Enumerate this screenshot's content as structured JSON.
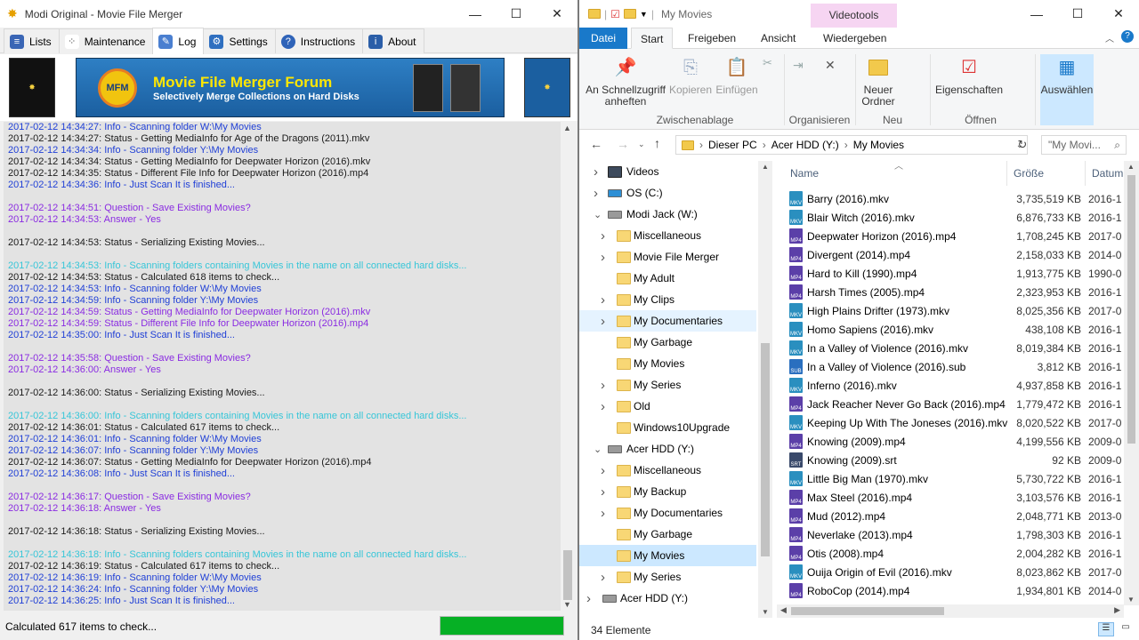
{
  "left_window": {
    "title": "Modi Original - Movie File Merger",
    "tabs": [
      {
        "label": "Lists",
        "icon": "lists-icon"
      },
      {
        "label": "Maintenance",
        "icon": "maintenance-icon"
      },
      {
        "label": "Log",
        "icon": "log-icon"
      },
      {
        "label": "Settings",
        "icon": "gear-icon"
      },
      {
        "label": "Instructions",
        "icon": "help-icon"
      },
      {
        "label": "About",
        "icon": "about-icon"
      }
    ],
    "active_tab": "Log",
    "banner": {
      "title": "Movie File Merger Forum",
      "subtitle": "Selectively Merge Collections on Hard Disks",
      "badge": "MFM"
    },
    "log_lines": [
      {
        "text": "2017-02-12 14:34:27: Info - Scanning folder W:\\My Movies",
        "type": "blue"
      },
      {
        "text": "2017-02-12 14:34:27: Status - Getting MediaInfo for Age of the Dragons (2011).mkv",
        "type": "black"
      },
      {
        "text": "2017-02-12 14:34:34: Info - Scanning folder Y:\\My Movies",
        "type": "blue"
      },
      {
        "text": "2017-02-12 14:34:34: Status - Getting MediaInfo for Deepwater Horizon (2016).mkv",
        "type": "black"
      },
      {
        "text": "2017-02-12 14:34:35: Status - Different File Info for Deepwater Horizon (2016).mp4",
        "type": "black"
      },
      {
        "text": "2017-02-12 14:34:36: Info - Just Scan It is finished...",
        "type": "blue"
      },
      {
        "text": "",
        "type": "black"
      },
      {
        "text": "2017-02-12 14:34:51: Question - Save Existing Movies?",
        "type": "purple"
      },
      {
        "text": "2017-02-12 14:34:53: Answer - Yes",
        "type": "purple"
      },
      {
        "text": "",
        "type": "black"
      },
      {
        "text": "2017-02-12 14:34:53: Status - Serializing Existing Movies...",
        "type": "black"
      },
      {
        "text": "",
        "type": "black"
      },
      {
        "text": "2017-02-12 14:34:53: Info - Scanning folders containing Movies in the name on all connected hard disks...",
        "type": "cyan"
      },
      {
        "text": "2017-02-12 14:34:53: Status - Calculated 618 items to check...",
        "type": "black"
      },
      {
        "text": "2017-02-12 14:34:53: Info - Scanning folder W:\\My Movies",
        "type": "blue"
      },
      {
        "text": "2017-02-12 14:34:59: Info - Scanning folder Y:\\My Movies",
        "type": "blue"
      },
      {
        "text": "2017-02-12 14:34:59: Status - Getting MediaInfo for Deepwater Horizon (2016).mkv",
        "type": "purple"
      },
      {
        "text": "2017-02-12 14:34:59: Status - Different File Info for Deepwater Horizon (2016).mp4",
        "type": "purple"
      },
      {
        "text": "2017-02-12 14:35:00: Info - Just Scan It is finished...",
        "type": "blue"
      },
      {
        "text": "",
        "type": "black"
      },
      {
        "text": "2017-02-12 14:35:58: Question - Save Existing Movies?",
        "type": "purple"
      },
      {
        "text": "2017-02-12 14:36:00: Answer - Yes",
        "type": "purple"
      },
      {
        "text": "",
        "type": "black"
      },
      {
        "text": "2017-02-12 14:36:00: Status - Serializing Existing Movies...",
        "type": "black"
      },
      {
        "text": "",
        "type": "black"
      },
      {
        "text": "2017-02-12 14:36:00: Info - Scanning folders containing Movies in the name on all connected hard disks...",
        "type": "cyan"
      },
      {
        "text": "2017-02-12 14:36:01: Status - Calculated 617 items to check...",
        "type": "black"
      },
      {
        "text": "2017-02-12 14:36:01: Info - Scanning folder W:\\My Movies",
        "type": "blue"
      },
      {
        "text": "2017-02-12 14:36:07: Info - Scanning folder Y:\\My Movies",
        "type": "blue"
      },
      {
        "text": "2017-02-12 14:36:07: Status - Getting MediaInfo for Deepwater Horizon (2016).mp4",
        "type": "black"
      },
      {
        "text": "2017-02-12 14:36:08: Info - Just Scan It is finished...",
        "type": "blue"
      },
      {
        "text": "",
        "type": "black"
      },
      {
        "text": "2017-02-12 14:36:17: Question - Save Existing Movies?",
        "type": "purple"
      },
      {
        "text": "2017-02-12 14:36:18: Answer - Yes",
        "type": "purple"
      },
      {
        "text": "",
        "type": "black"
      },
      {
        "text": "2017-02-12 14:36:18: Status - Serializing Existing Movies...",
        "type": "black"
      },
      {
        "text": "",
        "type": "black"
      },
      {
        "text": "2017-02-12 14:36:18: Info - Scanning folders containing Movies in the name on all connected hard disks...",
        "type": "cyan"
      },
      {
        "text": "2017-02-12 14:36:19: Status - Calculated 617 items to check...",
        "type": "black"
      },
      {
        "text": "2017-02-12 14:36:19: Info - Scanning folder W:\\My Movies",
        "type": "blue"
      },
      {
        "text": "2017-02-12 14:36:24: Info - Scanning folder Y:\\My Movies",
        "type": "blue"
      },
      {
        "text": "2017-02-12 14:36:25: Info - Just Scan It is finished...",
        "type": "blue"
      }
    ],
    "status_text": "Calculated 617 items to check...",
    "progress": 1.0,
    "colors": {
      "progress": "#06b025",
      "info": "#1f3fd6",
      "question": "#8a2be2",
      "scan": "#36c6d8"
    }
  },
  "right_window": {
    "title": "My Movies",
    "contextual_tab": "Videotools",
    "ribbon_tabs": [
      "Datei",
      "Start",
      "Freigeben",
      "Ansicht",
      "Wiedergeben"
    ],
    "active_ribbon_tab": "Start",
    "ribbon": {
      "pin": "An Schnellzugriff anheften",
      "copy": "Kopieren",
      "paste": "Einfügen",
      "group_clipboard": "Zwischenablage",
      "group_organize": "Organisieren",
      "new_folder": "Neuer Ordner",
      "group_new": "Neu",
      "properties": "Eigenschaften",
      "group_open": "Öffnen",
      "select": "Auswählen"
    },
    "address": {
      "breadcrumbs": [
        "Dieser PC",
        "Acer HDD (Y:)",
        "My Movies"
      ],
      "search_placeholder": "\"My Movi..."
    },
    "nav_tree": [
      {
        "label": "Videos",
        "level": 1,
        "kind": "videos",
        "chevron": "right"
      },
      {
        "label": "OS (C:)",
        "level": 1,
        "kind": "os-drive",
        "chevron": "right"
      },
      {
        "label": "Modi Jack (W:)",
        "level": 1,
        "kind": "drive",
        "chevron": "down"
      },
      {
        "label": "Miscellaneous",
        "level": 2,
        "kind": "folder",
        "chevron": "right"
      },
      {
        "label": "Movie File Merger",
        "level": 2,
        "kind": "folder",
        "chevron": "right"
      },
      {
        "label": "My Adult",
        "level": 2,
        "kind": "folder",
        "chevron": ""
      },
      {
        "label": "My Clips",
        "level": 2,
        "kind": "folder",
        "chevron": "right"
      },
      {
        "label": "My Documentaries",
        "level": 2,
        "kind": "folder",
        "chevron": "right",
        "state": "hover"
      },
      {
        "label": "My Garbage",
        "level": 2,
        "kind": "folder",
        "chevron": ""
      },
      {
        "label": "My Movies",
        "level": 2,
        "kind": "folder",
        "chevron": ""
      },
      {
        "label": "My Series",
        "level": 2,
        "kind": "folder",
        "chevron": "right"
      },
      {
        "label": "Old",
        "level": 2,
        "kind": "folder",
        "chevron": "right"
      },
      {
        "label": "Windows10Upgrade",
        "level": 2,
        "kind": "folder",
        "chevron": ""
      },
      {
        "label": "Acer HDD (Y:)",
        "level": 1,
        "kind": "drive",
        "chevron": "down"
      },
      {
        "label": "Miscellaneous",
        "level": 2,
        "kind": "folder",
        "chevron": "right"
      },
      {
        "label": "My Backup",
        "level": 2,
        "kind": "folder",
        "chevron": "right"
      },
      {
        "label": "My Documentaries",
        "level": 2,
        "kind": "folder",
        "chevron": "right"
      },
      {
        "label": "My Garbage",
        "level": 2,
        "kind": "folder",
        "chevron": ""
      },
      {
        "label": "My Movies",
        "level": 2,
        "kind": "folder",
        "chevron": "",
        "state": "selected"
      },
      {
        "label": "My Series",
        "level": 2,
        "kind": "folder",
        "chevron": "right"
      },
      {
        "label": "Acer HDD (Y:)",
        "level": 0,
        "kind": "drive",
        "chevron": "right"
      }
    ],
    "columns": {
      "name": "Name",
      "size": "Größe",
      "date": "Datum"
    },
    "files": [
      {
        "name": "Barry (2016).mkv",
        "size": "3,735,519 KB",
        "date": "2016-1",
        "ext": "MKV"
      },
      {
        "name": "Blair Witch (2016).mkv",
        "size": "6,876,733 KB",
        "date": "2016-1",
        "ext": "MKV"
      },
      {
        "name": "Deepwater Horizon (2016).mp4",
        "size": "1,708,245 KB",
        "date": "2017-0",
        "ext": "MP4"
      },
      {
        "name": "Divergent (2014).mp4",
        "size": "2,158,033 KB",
        "date": "2014-0",
        "ext": "MP4"
      },
      {
        "name": "Hard to Kill (1990).mp4",
        "size": "1,913,775 KB",
        "date": "1990-0",
        "ext": "MP4"
      },
      {
        "name": "Harsh Times (2005).mp4",
        "size": "2,323,953 KB",
        "date": "2016-1",
        "ext": "MP4"
      },
      {
        "name": "High Plains Drifter (1973).mkv",
        "size": "8,025,356 KB",
        "date": "2017-0",
        "ext": "MKV"
      },
      {
        "name": "Homo Sapiens (2016).mkv",
        "size": "438,108 KB",
        "date": "2016-1",
        "ext": "MKV"
      },
      {
        "name": "In a Valley of Violence (2016).mkv",
        "size": "8,019,384 KB",
        "date": "2016-1",
        "ext": "MKV"
      },
      {
        "name": "In a Valley of Violence (2016).sub",
        "size": "3,812 KB",
        "date": "2016-1",
        "ext": "SUB"
      },
      {
        "name": "Inferno (2016).mkv",
        "size": "4,937,858 KB",
        "date": "2016-1",
        "ext": "MKV"
      },
      {
        "name": "Jack Reacher Never Go Back (2016).mp4",
        "size": "1,779,472 KB",
        "date": "2016-1",
        "ext": "MP4"
      },
      {
        "name": "Keeping Up With The Joneses (2016).mkv",
        "size": "8,020,522 KB",
        "date": "2017-0",
        "ext": "MKV"
      },
      {
        "name": "Knowing (2009).mp4",
        "size": "4,199,556 KB",
        "date": "2009-0",
        "ext": "MP4"
      },
      {
        "name": "Knowing (2009).srt",
        "size": "92 KB",
        "date": "2009-0",
        "ext": "SRT"
      },
      {
        "name": "Little Big Man (1970).mkv",
        "size": "5,730,722 KB",
        "date": "2016-1",
        "ext": "MKV"
      },
      {
        "name": "Max Steel (2016).mp4",
        "size": "3,103,576 KB",
        "date": "2016-1",
        "ext": "MP4"
      },
      {
        "name": "Mud (2012).mp4",
        "size": "2,048,771 KB",
        "date": "2013-0",
        "ext": "MP4"
      },
      {
        "name": "Neverlake (2013).mp4",
        "size": "1,798,303 KB",
        "date": "2016-1",
        "ext": "MP4"
      },
      {
        "name": "Otis (2008).mp4",
        "size": "2,004,282 KB",
        "date": "2016-1",
        "ext": "MP4"
      },
      {
        "name": "Ouija Origin of Evil (2016).mkv",
        "size": "8,023,862 KB",
        "date": "2017-0",
        "ext": "MKV"
      },
      {
        "name": "RoboCop (2014).mp4",
        "size": "1,934,801 KB",
        "date": "2014-0",
        "ext": "MP4"
      }
    ],
    "status": "34 Elemente"
  }
}
